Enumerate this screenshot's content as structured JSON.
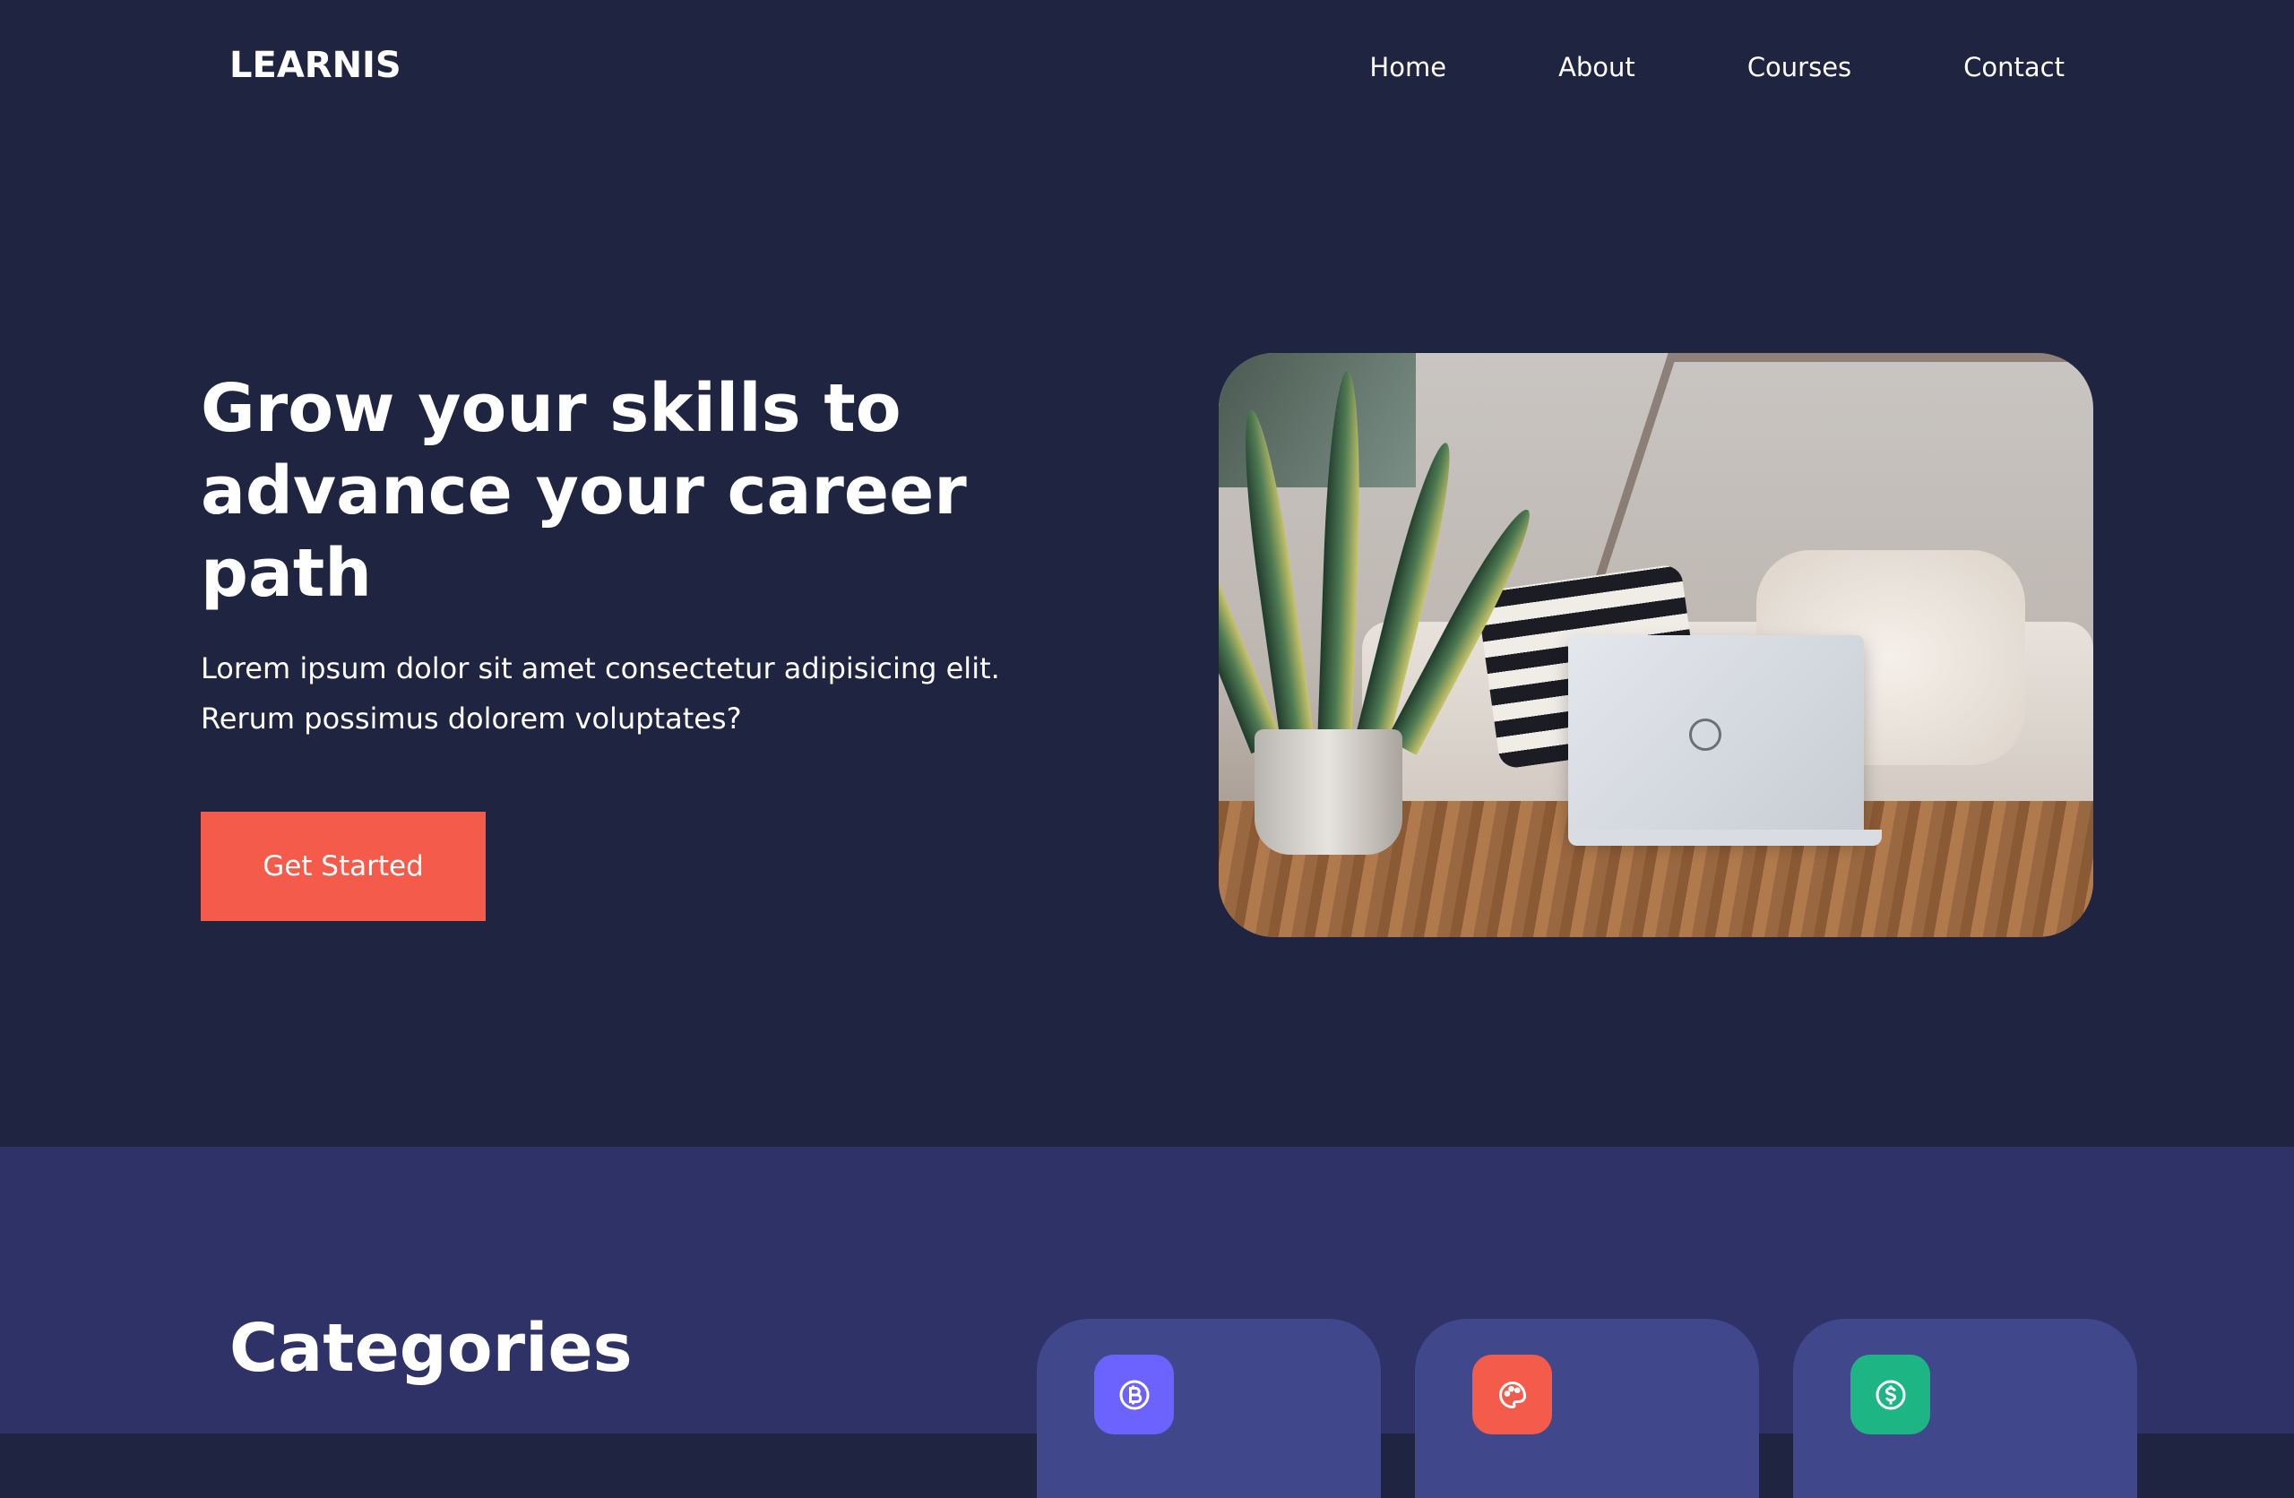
{
  "header": {
    "logo": "LEARNIS",
    "nav": [
      {
        "label": "Home"
      },
      {
        "label": "About"
      },
      {
        "label": "Courses"
      },
      {
        "label": "Contact"
      }
    ]
  },
  "hero": {
    "title": "Grow your skills to advance your career path",
    "description": "Lorem ipsum dolor sit amet consectetur adipisicing elit. Rerum possimus dolorem voluptates?",
    "cta_label": "Get Started",
    "image_alt": "laptop-and-plant-photo"
  },
  "categories": {
    "title": "Categories",
    "cards": [
      {
        "icon": "bitcoin-icon",
        "color": "#6c63ff"
      },
      {
        "icon": "palette-icon",
        "color": "#f45b4b"
      },
      {
        "icon": "dollar-icon",
        "color": "#1db584"
      }
    ]
  },
  "colors": {
    "background": "#1f2540",
    "section": "#2e3266",
    "card": "#40478a",
    "accent": "#f45b4b"
  }
}
